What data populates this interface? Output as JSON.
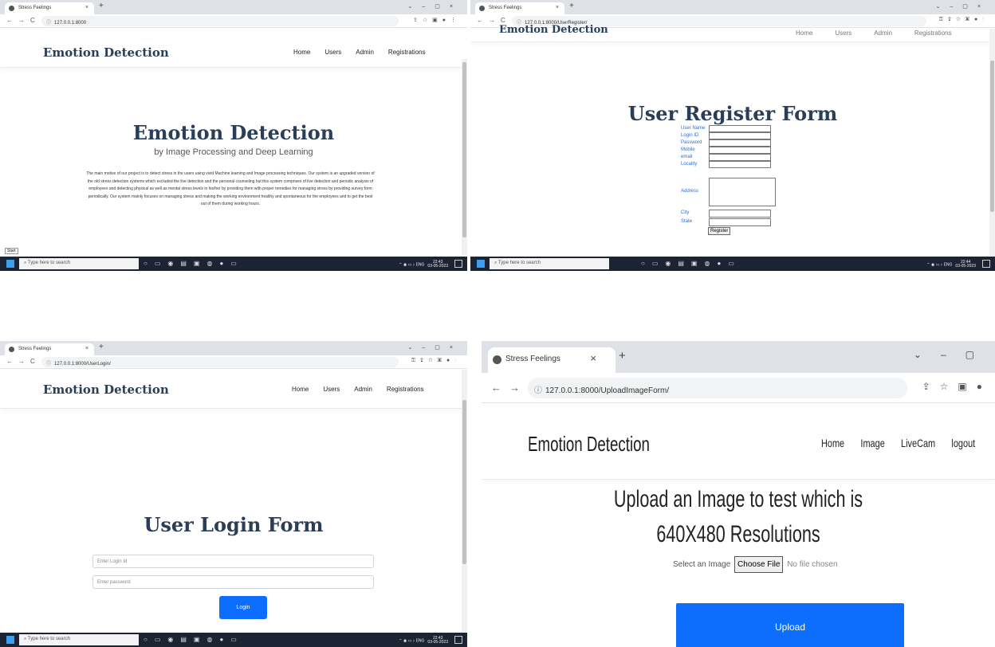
{
  "colors": {
    "brand": "#2a3e57",
    "link_label": "#2a6fd6",
    "primary_button": "#0d6efd",
    "taskbar": "#1c2433"
  },
  "browser": {
    "tab_title": "Stress Feelings"
  },
  "taskbar": {
    "search_placeholder": "Type here to search",
    "lang": "ENG"
  },
  "home": {
    "url": "127.0.0.1:8000",
    "clock_time": "22:43",
    "clock_date": "03-05-2023",
    "brand": "Emotion Detection",
    "nav": [
      "Home",
      "Users",
      "Admin",
      "Registrations"
    ],
    "title": "Emotion Detection",
    "subtitle": "by Image Processing and Deep Learning",
    "paragraph": "The main motive of our project is to detect stress in the users using vivid Machine learning and Image processing techniques. Our system is an upgraded version of the old stress detection systems which excluded the live detection and the personal counseling but this system comprises of live detection and periodic analysis of employees and detecting physical as well as mental stress levels in his/her by providing them with proper remedies for managing stress by providing survey form periodically. Our system mainly focuses on managing stress and making the working environment healthy and spontaneous for the employees and to get the best out of them during working hours.",
    "start_tag": "Start"
  },
  "register": {
    "url": "127.0.0.1:8000/UserRegister/",
    "clock_time": "22:44",
    "clock_date": "03-05-2023",
    "brand": "Emotion Detection",
    "nav": [
      "Home",
      "Users",
      "Admin",
      "Registrations"
    ],
    "title": "User Register Form",
    "fields": [
      "User Name",
      "Login ID",
      "Password",
      "Mobile",
      "email",
      "Locality",
      "Address",
      "City",
      "State"
    ],
    "submit": "Register"
  },
  "login": {
    "url": "127.0.0.1:8000/UserLogin/",
    "clock_time": "22:43",
    "clock_date": "03-05-2023",
    "brand": "Emotion Detection",
    "nav": [
      "Home",
      "Users",
      "Admin",
      "Registrations"
    ],
    "title": "User Login Form",
    "login_placeholder": "Enter Login Id",
    "password_placeholder": "Enter password",
    "submit": "Login"
  },
  "upload": {
    "url": "127.0.0.1:8000/UploadImageForm/",
    "brand": "Emotion Detection",
    "nav": [
      "Home",
      "Image",
      "LiveCam",
      "logout"
    ],
    "title_line1": "Upload an Image to test which is",
    "title_line2": "640X480 Resolutions",
    "select_label": "Select an Image",
    "choose_file": "Choose File",
    "no_file": "No file chosen",
    "submit": "Upload"
  }
}
